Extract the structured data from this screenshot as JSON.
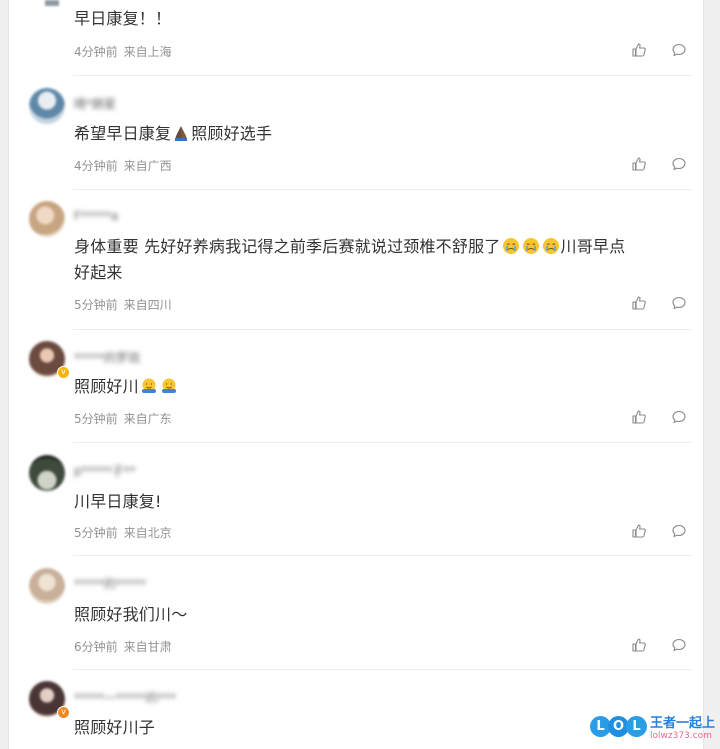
{
  "comments": [
    {
      "text": "早日康复！！",
      "time": "4分钟前",
      "location": "来自上海",
      "username": "",
      "avatar_color": "#9aa4ad"
    },
    {
      "text_before_emoji": "希望早日康复",
      "emoji": "pray",
      "text_after_emoji": "照顾好选手",
      "time": "4分钟前",
      "location": "来自广西",
      "username": "晴*朗星",
      "avatar_color": "#5f88a8"
    },
    {
      "text_line1_before_emoji": "身体重要 先好好养病我记得之前季后赛就说过颈椎不舒服了",
      "emoji": "crying-face",
      "emoji_count": 3,
      "text_line1_after_emoji": "川哥早点",
      "text_line2": "好起来",
      "time": "5分钟前",
      "location": "来自四川",
      "username": "F*****a",
      "avatar_color": "#c8a581"
    },
    {
      "text": "照顾好川",
      "emoji": "hug",
      "emoji_count": 2,
      "time": "5分钟前",
      "location": "来自广东",
      "username": "*****的罗琉",
      "avatar_color": "#6b4a3f",
      "verified": true
    },
    {
      "text": "川早日康复!",
      "time": "5分钟前",
      "location": "来自北京",
      "username": "p*****子**",
      "avatar_color": "#3e4a3c"
    },
    {
      "text": "照顾好我们川～",
      "time": "6分钟前",
      "location": "来自甘肃",
      "username": "*****的*****",
      "avatar_color": "#c9b09a"
    },
    {
      "text": "照顾好川子",
      "time": "",
      "location": "",
      "username": "*****一*****的***",
      "avatar_color": "#4a3535",
      "verified": true
    }
  ],
  "watermark": {
    "brand": "王者一起上",
    "url": "lolwz373.com",
    "letters": [
      "L",
      "O",
      "L"
    ]
  },
  "icons": {
    "like": "thumbs-up-icon",
    "reply": "comment-bubble-icon"
  },
  "colors": {
    "meta": "#939393",
    "text": "#333333",
    "divider": "#ececec",
    "icon": "#8a8a8a"
  }
}
